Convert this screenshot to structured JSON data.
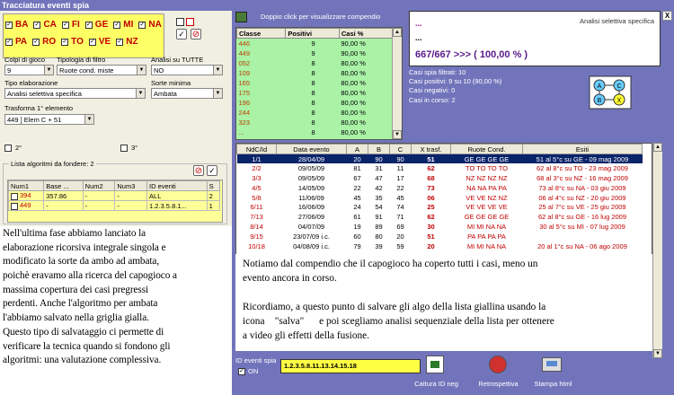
{
  "window": {
    "title": "Tracciatura eventi spia"
  },
  "wheels": {
    "row1": [
      "BA",
      "CA",
      "FI",
      "GE",
      "MI",
      "NA"
    ],
    "row2": [
      "PA",
      "RO",
      "TO",
      "VE",
      "NZ"
    ]
  },
  "filters": {
    "colpi_label": "Colpi di gioco",
    "colpi_value": "9",
    "tipologia_label": "Tipologia di filtro",
    "tipologia_value": "Ruote cond. miste",
    "analisi_label": "Analisi su TUTTE",
    "analisi_value": "NO",
    "tipo_label": "Tipo elaborazione",
    "tipo_value": "Analisi selettiva specifica",
    "sorte_label": "Sorte minima",
    "sorte_value": "Ambata",
    "trasforma_label": "Trasforma 1° elemento",
    "trasforma_value": "449 ] Elem C + 51",
    "secondo": "2°",
    "terzo": "3°"
  },
  "algo_list": {
    "title": "Lista algoritmi da fondere: 2",
    "headers": [
      "Num1",
      "Base ...",
      "Num2",
      "Num3",
      "ID eventi",
      "S"
    ],
    "rows": [
      [
        "394",
        "357.86",
        "-",
        "-",
        "ALL",
        "2"
      ],
      [
        "449",
        "-",
        "-",
        "-",
        "1.2.3.5.8.1...",
        "1"
      ]
    ]
  },
  "note_left": [
    "Nell'ultima fase abbiamo lanciato la",
    "elaborazione ricorsiva integrale singola e",
    "modificato la sorte da ambo ad ambata,",
    "poichè eravamo alla ricerca del capogioco a",
    "massima copertura dei casi pregressi",
    "perdenti. Anche l'algoritmo per ambata",
    "l'abbiamo salvato nella griglia gialla.",
    "Questo tipo di salvataggio ci permette di",
    "verificare la tecnica quando si fondono gli",
    "algoritmi: una valutazione complessiva."
  ],
  "compendio": {
    "hint": "Doppio click per visualizzare compendio",
    "headers": [
      "Classe",
      "Positivi",
      "Casi %"
    ],
    "rows": [
      [
        "446",
        "9",
        "90,00 %"
      ],
      [
        "449",
        "9",
        "90,00 %"
      ],
      [
        "052",
        "8",
        "80,00 %"
      ],
      [
        "109",
        "8",
        "80,00 %"
      ],
      [
        "165",
        "8",
        "80,00 %"
      ],
      [
        "175",
        "8",
        "80,00 %"
      ],
      [
        "196",
        "8",
        "80,00 %"
      ],
      [
        "244",
        "8",
        "80,00 %"
      ],
      [
        "323",
        "8",
        "80,00 %"
      ],
      [
        "...",
        "8",
        "80,00 %"
      ]
    ]
  },
  "info": {
    "line1": "...",
    "line2": "...",
    "right_label": "Analisi selettiva specifica",
    "big": "667/667 >>> ( 100,00 % )"
  },
  "stats": [
    "Casi spia filtrati: 10",
    "Casi positivi: 9 su 10 (90,00 %)",
    "Casi negativi: 0",
    "Casi in corso: 2"
  ],
  "diagram": {
    "nodes": [
      "A",
      "C",
      "B",
      "X"
    ]
  },
  "events": {
    "headers": [
      "NdC/Id",
      "Data evento",
      "A",
      "B",
      "C",
      "X trasf.",
      "Ruote Cond.",
      "Esiti"
    ],
    "rows": [
      [
        "1/1",
        "28/04/09",
        "20",
        "90",
        "90",
        "51",
        "GE GE GE GE",
        "51 al 5°c su GE - 09 mag 2009"
      ],
      [
        "2/2",
        "09/05/09",
        "81",
        "31",
        "11",
        "62",
        "TO TO TO TO",
        "62 al 8°c su TO - 23 mag 2009"
      ],
      [
        "3/3",
        "09/05/09",
        "67",
        "47",
        "17",
        "68",
        "NZ NZ NZ NZ",
        "68 al 3°c su NZ - 16 mag 2009"
      ],
      [
        "4/5",
        "14/05/09",
        "22",
        "42",
        "22",
        "73",
        "NA NA PA PA",
        "73 al 8°c su NA - 03 giu 2009"
      ],
      [
        "5/8",
        "11/06/09",
        "45",
        "35",
        "45",
        "06",
        "VE VE NZ NZ",
        "06 al 4°c su NZ - 20 giu 2009"
      ],
      [
        "6/11",
        "16/06/09",
        "24",
        "54",
        "74",
        "25",
        "VE VE VE VE",
        "25 al 7°c su VE - 25 giu 2009"
      ],
      [
        "7/13",
        "27/06/09",
        "61",
        "91",
        "71",
        "62",
        "GE GE GE GE",
        "62 al 8°c su GE - 16 lug 2009"
      ],
      [
        "8/14",
        "04/07/09",
        "19",
        "89",
        "69",
        "30",
        "MI MI NA NA",
        "30 al 5°c su MI - 07 lug 2009"
      ],
      [
        "9/15",
        "23/07/09 i.c.",
        "60",
        "80",
        "20",
        "51",
        "PA PA PA PA",
        ""
      ],
      [
        "10/18",
        "04/08/09 i.c.",
        "79",
        "39",
        "59",
        "20",
        "MI MI NA NA",
        "20 al 1°c su NA - 06 ago 2009"
      ]
    ]
  },
  "note_right": [
    "Notiamo dal compendio che il capogioco ha coperto tutti i casi, meno un",
    "evento ancora in corso.",
    "",
    "Ricordiamo, a questo punto di salvare gli algo della lista giallina usando la",
    "icona    \"salva\"      e poi scegliamo analisi sequenziale della lista per ottenere",
    "a video gli effetti della fusione."
  ],
  "bottom": {
    "id_label": "ID eventi spia",
    "id_value": "1.2.3.5.8.11.13.14.15.18",
    "on_label": "ON",
    "btn1": "Cattura ID neg",
    "btn2": "Retrospettiva",
    "btn3": "Stampa html"
  },
  "close": "X"
}
